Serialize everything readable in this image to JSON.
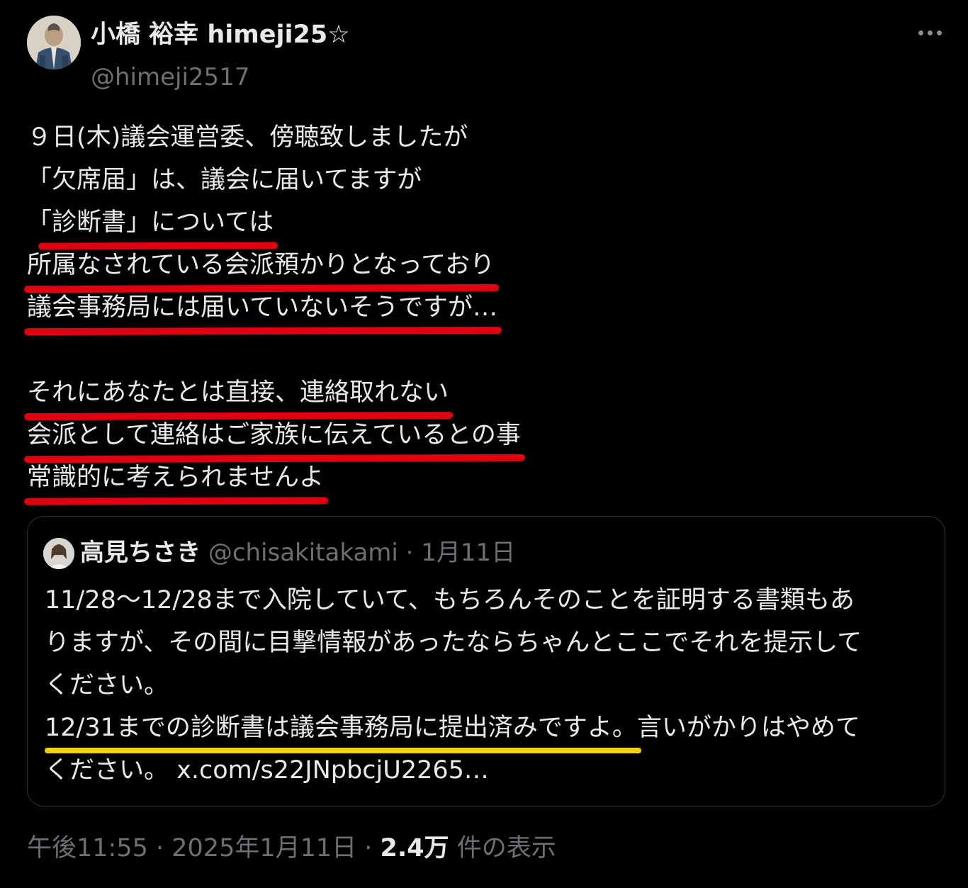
{
  "author": {
    "display_name": "小橋 裕幸 himeji25☆",
    "handle": "@himeji2517"
  },
  "post": {
    "lines": [
      "９日(木)議会運営委、傍聴致しましたが",
      "「欠席届」は、議会に届いてますが",
      "「診断書」については",
      "所属なされている会派預かりとなっており",
      "議会事務局には届いていないそうですが…",
      "",
      "それにあなたとは直接、連絡取れない",
      "会派として連絡はご家族に伝えているとの事",
      "常識的に考えられませんよ"
    ]
  },
  "quote": {
    "display_name": "高見ちさき",
    "handle": "@chisakitakami",
    "separator": "·",
    "date": "1月11日",
    "lines": [
      "11/28～12/28まで入院していて、もちろんそのことを証明する書類もあ",
      "りますが、その間に目撃情報があったならちゃんとここでそれを提示して",
      "ください。"
    ],
    "highlight_line": "12/31までの診断書は議会事務局に提出済みですよ。",
    "highlight_rest": "言いがかりはやめて",
    "last_line_text": "ください。 ",
    "link": "x.com/s22JNpbcjU2265…"
  },
  "footer": {
    "time": "午後11:55",
    "sep1": " · ",
    "date": "2025年1月11日",
    "sep2": " · ",
    "views_count": "2.4万",
    "views_label": " 件の表示"
  },
  "icons": {
    "more": "more-horizontal-icon"
  },
  "colors": {
    "background": "#000000",
    "text": "#e7e9ea",
    "muted": "#6b7075",
    "underline_red": "#e00010",
    "underline_yellow": "#f5d200"
  }
}
